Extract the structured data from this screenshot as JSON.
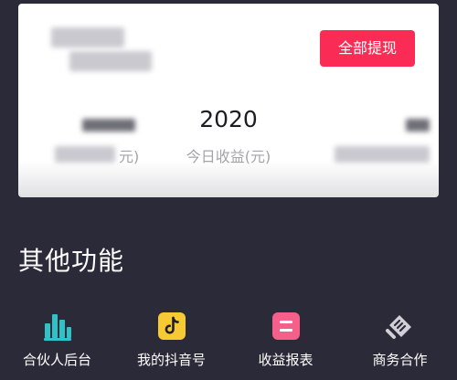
{
  "card": {
    "withdraw_button": "全部提现",
    "today_earnings": {
      "value": "2020",
      "label": "今日收益(元)"
    },
    "left_unit": "元)"
  },
  "section": {
    "title": "其他功能"
  },
  "features": [
    {
      "label": "合伙人后台",
      "icon": "bar-chart-icon",
      "color": "#2fc3c8"
    },
    {
      "label": "我的抖音号",
      "icon": "douyin-icon",
      "color": "#f7c932"
    },
    {
      "label": "收益报表",
      "icon": "report-icon",
      "color": "#f4608a"
    },
    {
      "label": "商务合作",
      "icon": "handshake-icon",
      "color": "#d0d0d6"
    }
  ],
  "colors": {
    "background": "#2b2a38",
    "accent": "#fa2c55"
  }
}
